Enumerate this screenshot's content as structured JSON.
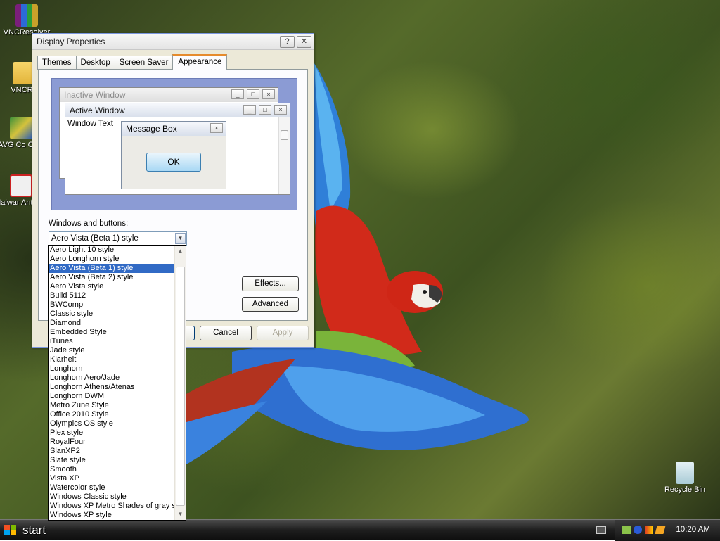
{
  "desktop": {
    "icons": [
      {
        "label": "VNCResolver",
        "icon": "winrar-icon"
      },
      {
        "label": "VNCRe",
        "icon": "folder-icon"
      },
      {
        "label": "AVG Co Cent",
        "icon": "avg-icon"
      },
      {
        "label": "Malwar Anti-Ma",
        "icon": "malwarebytes-icon"
      },
      {
        "label": "Recycle Bin",
        "icon": "recycle-bin-icon"
      }
    ]
  },
  "dialog": {
    "title": "Display Properties",
    "help_btn": "?",
    "close_btn": "✕",
    "tabs": [
      "Themes",
      "Desktop",
      "Screen Saver",
      "Appearance"
    ],
    "active_tab": "Appearance",
    "preview": {
      "inactive_title": "Inactive Window",
      "active_title": "Active Window",
      "window_text": "Window Text",
      "message_box_title": "Message Box",
      "ok_label": "OK"
    },
    "windows_buttons_label": "Windows and buttons:",
    "selected_style": "Aero Vista (Beta 1) style",
    "effects_label": "Effects...",
    "advanced_label": "Advanced",
    "cancel_label": "Cancel",
    "apply_label": "Apply"
  },
  "dropdown": {
    "items": [
      "Aero Light 10 style",
      "Aero Longhorn style",
      "Aero Vista (Beta 1) style",
      "Aero Vista (Beta 2) style",
      "Aero Vista style",
      "Build 5112",
      "BWComp",
      "Classic style",
      "Diamond",
      "Embedded Style",
      "iTunes",
      "Jade style",
      "Klarheit",
      "Longhorn",
      "Longhorn Aero/Jade",
      "Longhorn Athens/Atenas",
      "Longhorn DWM",
      "Metro Zune Style",
      "Office 2010 Style",
      "Olympics OS style",
      "Plex style",
      "RoyalFour",
      "SlanXP2",
      "Slate style",
      "Smooth",
      "Vista XP",
      "Watercolor style",
      "Windows Classic style",
      "Windows XP Metro Shades of gray st",
      "Windows XP style"
    ],
    "selected_index": 2
  },
  "taskbar": {
    "start_label": "start",
    "clock": "10:20 AM"
  },
  "colors": {
    "selection": "#316ac5",
    "dialog_bg": "#ece9d8",
    "tab_accent": "#e68b2c"
  }
}
